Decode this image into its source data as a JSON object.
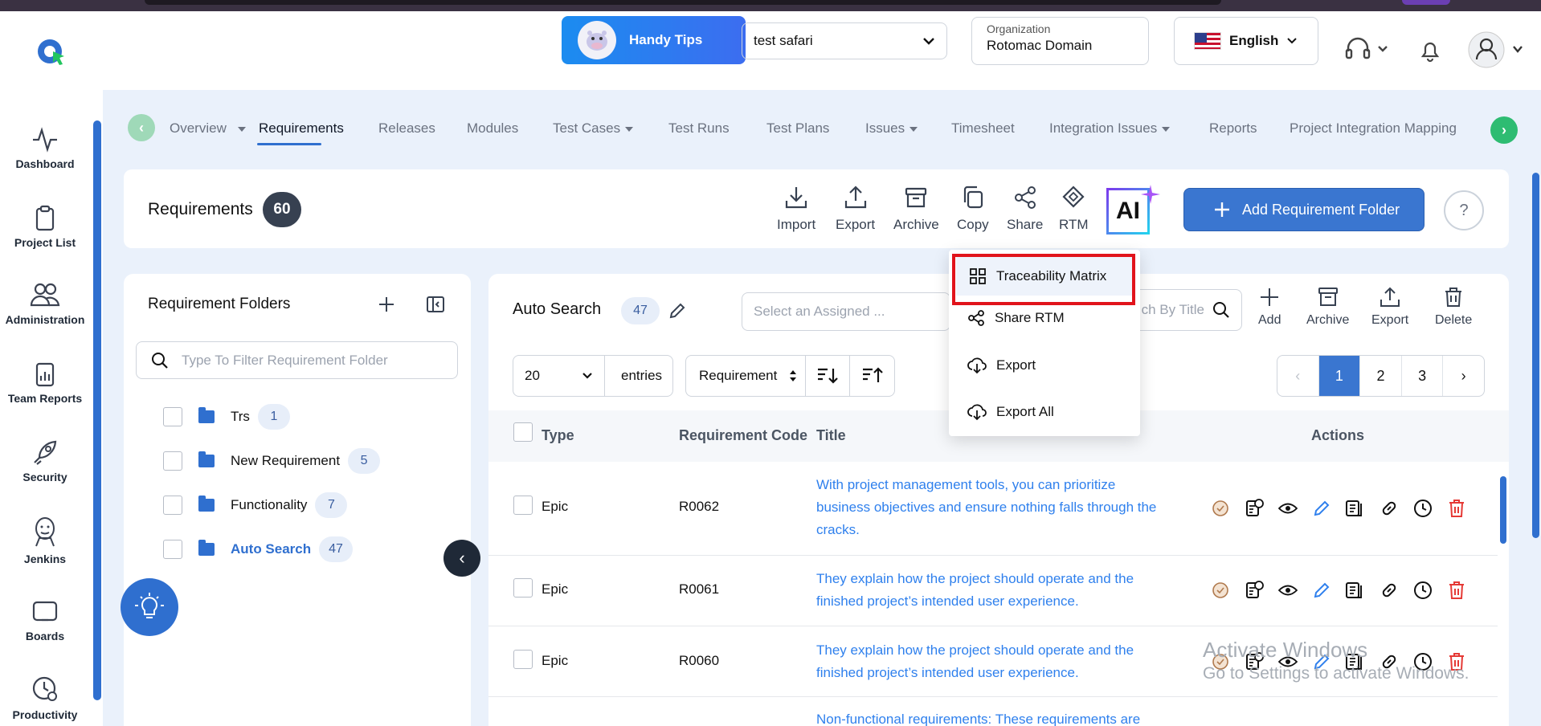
{
  "header": {
    "tips_label": "Handy Tips",
    "project_select": "test safari",
    "org_label": "Organization",
    "org_value": "Rotomac Domain",
    "language": "English"
  },
  "sidebar": {
    "items": [
      {
        "label": "Dashboard",
        "icon": "pulse-icon"
      },
      {
        "label": "Project List",
        "icon": "clipboard-icon"
      },
      {
        "label": "Administration",
        "icon": "users-icon"
      },
      {
        "label": "Team Reports",
        "icon": "report-icon"
      },
      {
        "label": "Security",
        "icon": "rocket-icon"
      },
      {
        "label": "Jenkins",
        "icon": "jenkins-icon"
      },
      {
        "label": "Boards",
        "icon": "board-icon"
      },
      {
        "label": "Productivity",
        "icon": "clock-gear-icon"
      }
    ]
  },
  "tabs": [
    {
      "label": "Overview",
      "dropdown": true
    },
    {
      "label": "Requirements",
      "active": true
    },
    {
      "label": "Releases"
    },
    {
      "label": "Modules"
    },
    {
      "label": "Test Cases",
      "dropdown": true
    },
    {
      "label": "Test Runs"
    },
    {
      "label": "Test Plans"
    },
    {
      "label": "Issues",
      "dropdown": true
    },
    {
      "label": "Timesheet"
    },
    {
      "label": "Integration Issues",
      "dropdown": true
    },
    {
      "label": "Reports"
    },
    {
      "label": "Project Integration Mapping"
    }
  ],
  "requirements": {
    "title": "Requirements",
    "count": "60",
    "tools": [
      "Import",
      "Export",
      "Archive",
      "Copy",
      "Share",
      "RTM"
    ],
    "ai_label": "AI",
    "add_folder_label": "Add Requirement Folder",
    "help_label": "?"
  },
  "folders": {
    "title": "Requirement Folders",
    "filter_placeholder": "Type To Filter Requirement Folder",
    "items": [
      {
        "name": "Trs",
        "count": "1"
      },
      {
        "name": "New Requirement",
        "count": "5"
      },
      {
        "name": "Functionality",
        "count": "7"
      },
      {
        "name": "Auto Search",
        "count": "47",
        "active": true
      }
    ]
  },
  "table_panel": {
    "title": "Auto Search",
    "count": "47",
    "assign_placeholder": "Select an Assigned ...",
    "title_search_placeholder": "ch By Title",
    "tools": [
      "Add",
      "Archive",
      "Export",
      "Delete"
    ],
    "entries_value": "20",
    "entries_label": "entries",
    "sort_field": "Requirement",
    "pages": [
      "‹",
      "1",
      "2",
      "3",
      "›"
    ],
    "columns": [
      "Type",
      "Requirement Code",
      "Title",
      "Actions"
    ],
    "rows": [
      {
        "type": "Epic",
        "code": "R0062",
        "title": "With project management tools, you can prioritize business objectives and ensure nothing falls through the cracks."
      },
      {
        "type": "Epic",
        "code": "R0061",
        "title": "They explain how the project should operate and the finished project’s intended user experience."
      },
      {
        "type": "Epic",
        "code": "R0060",
        "title": "They explain how the project should operate and the finished project’s intended user experience."
      },
      {
        "type": "",
        "code": "",
        "title": "Non-functional requirements: These requirements are"
      }
    ]
  },
  "rtm_menu": {
    "items": [
      {
        "label": "Traceability Matrix",
        "icon": "grid-icon"
      },
      {
        "label": "Share RTM",
        "icon": "share-icon"
      },
      {
        "label": "Export",
        "icon": "cloud-download-icon"
      },
      {
        "label": "Export All",
        "icon": "cloud-download-icon"
      }
    ]
  },
  "watermark": {
    "line1": "Activate Windows",
    "line2": "Go to Settings to activate Windows."
  },
  "colors": {
    "accent": "#2f6fcf",
    "highlight_box": "#e1131b",
    "main_bg": "#eaf1fb"
  }
}
